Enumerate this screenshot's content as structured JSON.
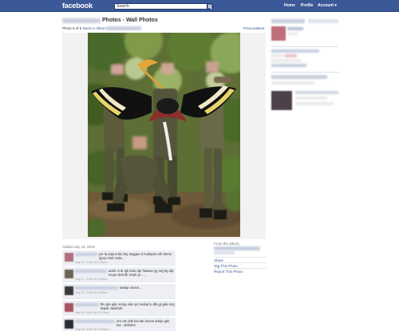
{
  "header": {
    "logo": "facebook",
    "search_placeholder": "Search",
    "nav": [
      "Home",
      "Profile",
      "Account ▾"
    ]
  },
  "title": {
    "text": "Photos - Wall Photos"
  },
  "photo_nav": {
    "count": "Photo 6 of 6",
    "back_label": "Back to Album",
    "previous": "Previous",
    "next": "Next"
  },
  "added": "Added July 16, 2010",
  "comments": [
    {
      "text": "yer la pupus bla bnj anggan d malaysia nih demo igoyu dah mula...",
      "time": "July 17, 2010 at 2:20pm",
      "avatar": "#b07080"
    },
    {
      "text": "aduh ni dr tgk kalu dpr haiwan yg org kg dpt mcpe skrit tlk sinah je......",
      "time": "July 17, 2010 at 3:52pm",
      "avatar": "#6b6457"
    },
    {
      "text": "sadap ooooo...",
      "time": "July 17, 2010 at 4:02pm",
      "avatar": "#3a3a3a"
    },
    {
      "text": "blu gtu gak orang utan pn sedap tu dlk jgi gak ong dapat Jaitahah",
      "time": "July 18, 2010 at 12:24am",
      "avatar": "#a85560"
    },
    {
      "text": "ore utn dok tau lak burew aduje gak kor...Jtahahx",
      "time": "July 18, 2010 at 12:46pm",
      "avatar": "#2a2d33"
    }
  ],
  "from_album": {
    "label": "From the album:",
    "links": [
      "Share",
      "Tag This Photo",
      "Report This Photo"
    ]
  },
  "colors": {
    "brand": "#3b5998",
    "link": "#3b5998",
    "comment_bg": "#edeff4"
  }
}
